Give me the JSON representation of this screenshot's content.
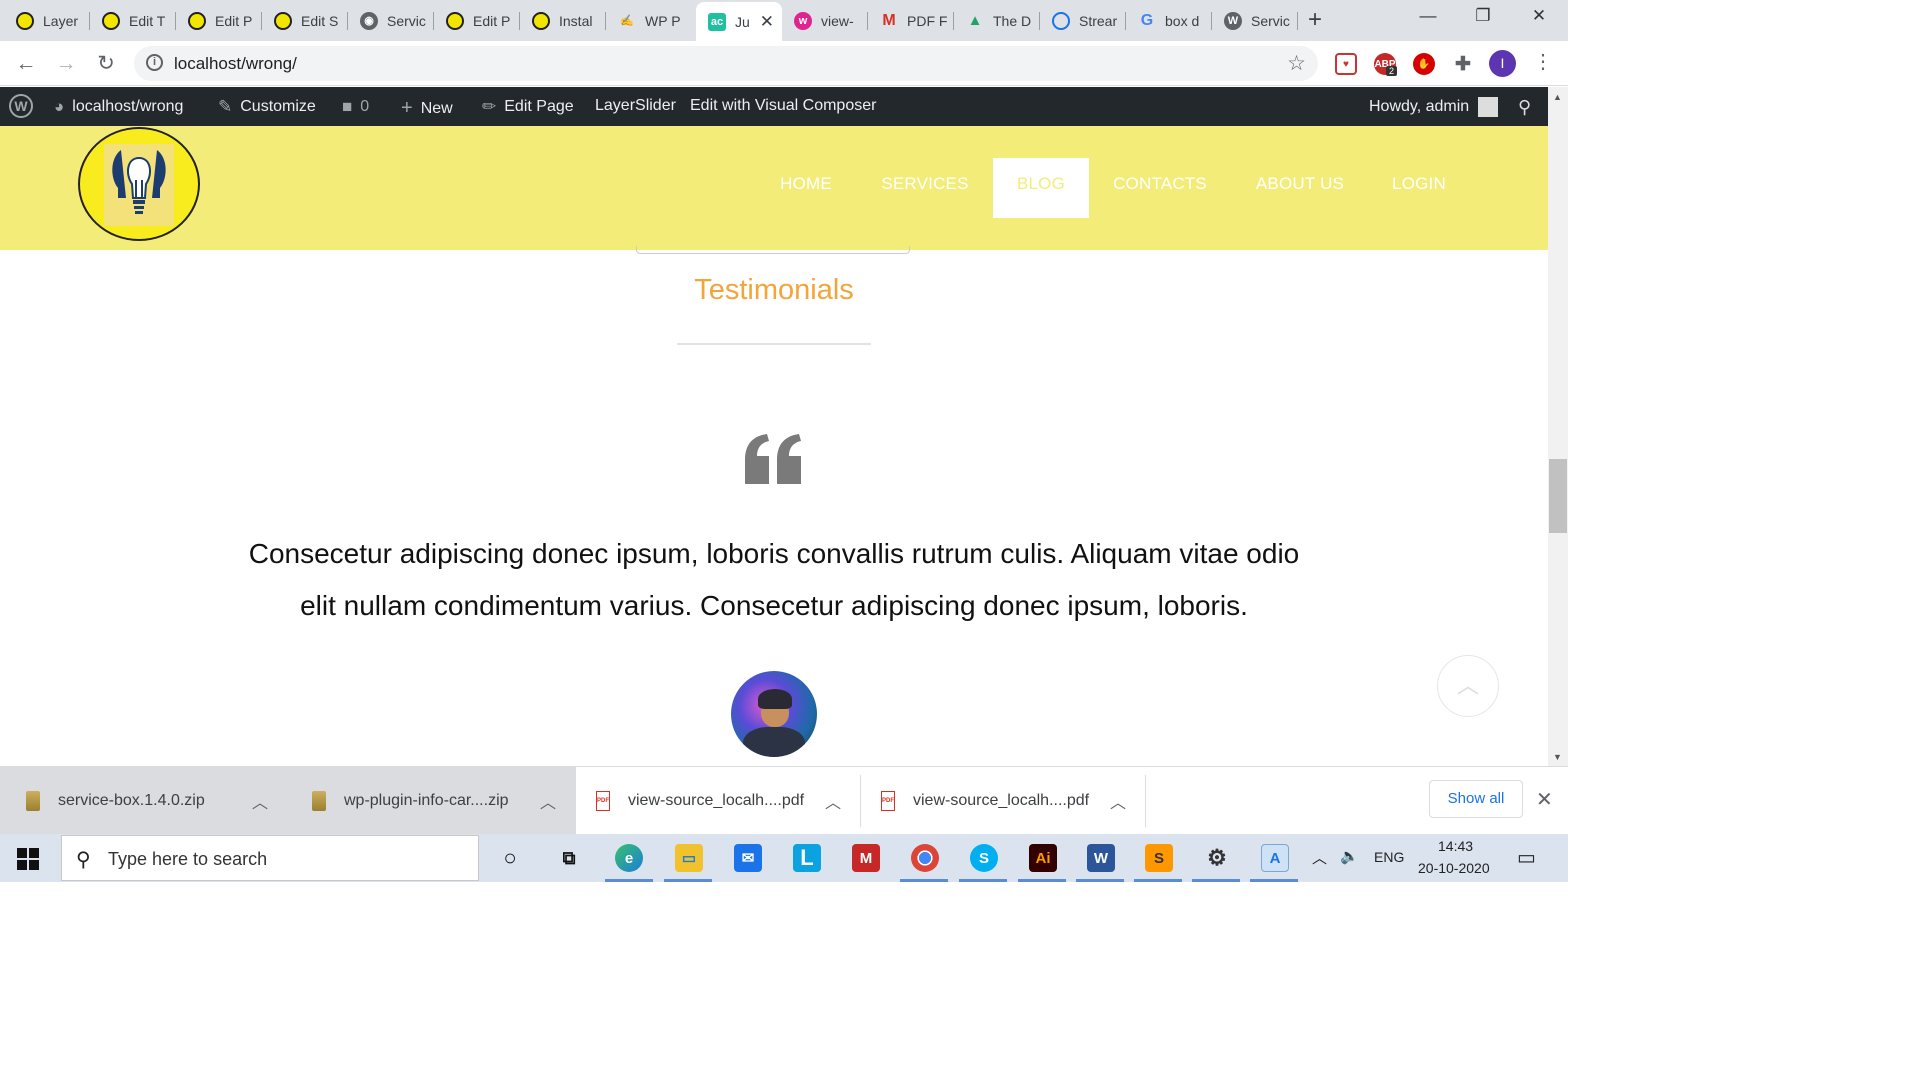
{
  "browser": {
    "tabs": [
      {
        "title": "Layer",
        "fav": "bulb"
      },
      {
        "title": "Edit T",
        "fav": "bulb"
      },
      {
        "title": "Edit P",
        "fav": "bulb"
      },
      {
        "title": "Edit S",
        "fav": "bulb"
      },
      {
        "title": "Servic",
        "fav": "globe"
      },
      {
        "title": "Edit P",
        "fav": "bulb"
      },
      {
        "title": "Instal",
        "fav": "bulb"
      },
      {
        "title": "WP P",
        "fav": "wp-plugin"
      },
      {
        "title": "Ju",
        "fav": "ac",
        "active": true
      },
      {
        "title": "view-",
        "fav": "w-pink"
      },
      {
        "title": "PDF F",
        "fav": "gmail"
      },
      {
        "title": "The D",
        "fav": "drive"
      },
      {
        "title": "Strear",
        "fav": "stream"
      },
      {
        "title": "box d",
        "fav": "google"
      },
      {
        "title": "Servic",
        "fav": "wordpress"
      }
    ],
    "new_tab_symbol": "+",
    "window_controls": {
      "minimize": "—",
      "restore": "❐",
      "close": "✕"
    },
    "url": "localhost/wrong/",
    "profile_initial": "I",
    "extension_badge": "2"
  },
  "wp_admin_bar": {
    "site_name": "localhost/wrong",
    "customize": "Customize",
    "comments_count": "0",
    "new": "New",
    "edit_page": "Edit Page",
    "layerslider": "LayerSlider",
    "visual_composer": "Edit with Visual Composer",
    "howdy": "Howdy, admin"
  },
  "site": {
    "menu": [
      "HOME",
      "SERVICES",
      "BLOG",
      "CONTACTS",
      "ABOUT US",
      "LOGIN"
    ],
    "active_menu": "BLOG",
    "colors": {
      "header_bg": "#f4ec79",
      "accent": "#f3a53a"
    }
  },
  "content": {
    "section_title": "Testimonials",
    "quote_line1": "Consecetur adipiscing donec ipsum, loboris convallis rutrum culis. Aliquam vitae odio",
    "quote_line2": "elit nullam condimentum varius. Consecetur adipiscing donec ipsum, loboris."
  },
  "downloads": [
    {
      "name": "service-box.1.4.0.zip",
      "type": "zip"
    },
    {
      "name": "wp-plugin-info-car....zip",
      "type": "zip"
    },
    {
      "name": "view-source_localh....pdf",
      "type": "pdf"
    },
    {
      "name": "view-source_localh....pdf",
      "type": "pdf"
    }
  ],
  "show_all": "Show all",
  "taskbar": {
    "search_placeholder": "Type here to search",
    "language": "ENG",
    "time": "14:43",
    "date": "20-10-2020"
  }
}
